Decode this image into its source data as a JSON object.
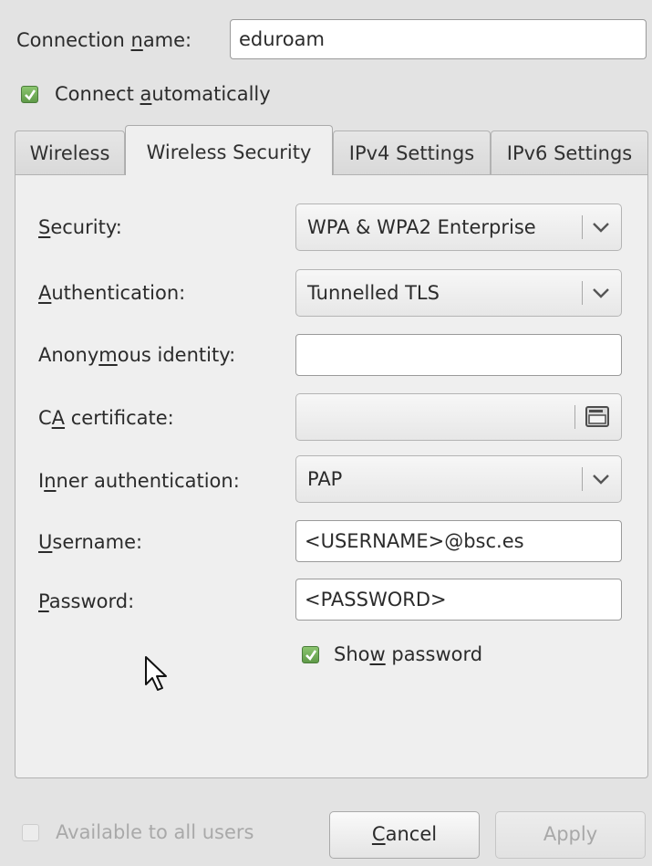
{
  "connection": {
    "name_label_pre": "Connection ",
    "name_label_key": "n",
    "name_label_post": "ame:",
    "name_value": "eduroam",
    "auto_label_pre": "Connect ",
    "auto_label_key": "a",
    "auto_label_post": "utomatically",
    "auto_checked": true
  },
  "tabs": [
    {
      "label": "Wireless",
      "active": false
    },
    {
      "label": "Wireless Security",
      "active": true
    },
    {
      "label": "IPv4 Settings",
      "active": false
    },
    {
      "label": "IPv6 Settings",
      "active": false
    }
  ],
  "security": {
    "security_label_key": "S",
    "security_label_post": "ecurity:",
    "security_value": "WPA & WPA2 Enterprise",
    "auth_label_key": "A",
    "auth_label_post": "uthentication:",
    "auth_value": "Tunnelled TLS",
    "anon_label_pre": "Anony",
    "anon_label_key": "m",
    "anon_label_post": "ous identity:",
    "anon_value": "",
    "ca_label_pre": "C",
    "ca_label_key": "A",
    "ca_label_post": " certificate:",
    "ca_value": "",
    "inner_label_pre": "I",
    "inner_label_key": "n",
    "inner_label_post": "ner authentication:",
    "inner_value": "PAP",
    "user_label_key": "U",
    "user_label_post": "sername:",
    "user_value": "<USERNAME>@bsc.es",
    "pass_label_key": "P",
    "pass_label_post": "assword:",
    "pass_value": "<PASSWORD>",
    "show_label_pre": "Sho",
    "show_label_key": "w",
    "show_label_post": " password",
    "show_checked": true
  },
  "footer": {
    "available_label": "Available to all users",
    "available_checked": false,
    "cancel_key": "C",
    "cancel_post": "ancel",
    "apply_label": "Apply"
  },
  "icons": {
    "check": "checkmark-icon",
    "chevron": "chevron-down-icon",
    "file": "file-browse-icon",
    "cursor": "mouse-pointer-icon"
  },
  "colors": {
    "accent_check": "#6aa84f",
    "window_bg": "#e3e3e3",
    "panel_bg": "#efefef"
  }
}
